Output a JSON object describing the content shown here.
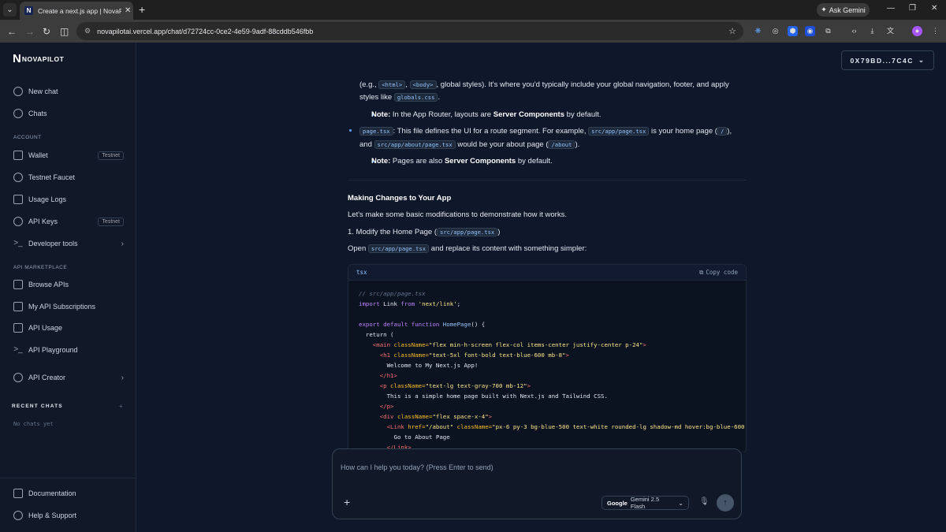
{
  "browser": {
    "tab_title": "Create a next.js app | NovaPilot",
    "tab_favicon": "N",
    "ask_gemini": "Ask Gemini",
    "url": "novapilotai.vercel.app/chat/d72724cc-0ce2-4e59-9adf-88cddb546fbb"
  },
  "sidebar": {
    "logo": "NOVAPILOT",
    "logo_mark": "N",
    "new_chat": "New chat",
    "chats": "Chats",
    "account_heading": "ACCOUNT",
    "wallet": "Wallet",
    "wallet_badge": "Testnet",
    "faucet": "Testnet Faucet",
    "usage_logs": "Usage Logs",
    "api_keys": "API Keys",
    "api_keys_badge": "Testnet",
    "dev_tools": "Developer tools",
    "marketplace_heading": "API MARKETPLACE",
    "browse_apis": "Browse APIs",
    "my_subs": "My API Subscriptions",
    "api_usage": "API Usage",
    "api_playground": "API Playground",
    "api_creator": "API Creator",
    "recent_heading": "RECENT CHATS",
    "no_chats": "No chats yet",
    "documentation": "Documentation",
    "help": "Help & Support"
  },
  "wallet_button": "0X79BD...7C4C",
  "message": {
    "p1_a": "(e.g., ",
    "code_html": "<html>",
    "p1_b": ", ",
    "code_body": "<body>",
    "p1_c": ", global styles). It's where you'd typically include your global navigation, footer, and apply",
    "p1_d": "styles like ",
    "code_globals": "globals.css",
    "p1_e": ".",
    "note1_label": "Note:",
    "note1_a": " In the App Router, layouts are ",
    "note1_bold": "Server Components",
    "note1_b": " by default.",
    "code_page": "page.tsx",
    "p2_a": ": This file defines the UI for a route segment. For example, ",
    "code_apppage": "src/app/page.tsx",
    "p2_b": " is your home page (",
    "code_slash": "/",
    "p2_c": "),",
    "p2_d": "and ",
    "code_about": "src/app/about/page.tsx",
    "p2_e": " would be your about page (",
    "code_aboutpath": "/about",
    "p2_f": ").",
    "note2_label": "Note:",
    "note2_a": " Pages are also ",
    "note2_bold": "Server Components",
    "note2_b": " by default.",
    "heading": "Making Changes to Your App",
    "intro": "Let's make some basic modifications to demonstrate how it works.",
    "step1_a": "1. Modify the Home Page (",
    "code_step1": "src/app/page.tsx",
    "step1_b": ")",
    "open_a": "Open ",
    "code_open": "src/app/page.tsx",
    "open_b": " and replace its content with something simpler:"
  },
  "codeblock": {
    "lang": "tsx",
    "copy": "Copy code",
    "comment": "// src/app/page.tsx",
    "import_kw": "import",
    "import_name": " Link ",
    "from_kw": "from",
    "import_str": " 'next/link'",
    "import_end": ";",
    "export_kw": "export default function",
    "fn_name": " HomePage",
    "fn_end": "() {",
    "return": "  return (",
    "main_open_tag": "    <main",
    "main_attr": " className=",
    "main_val": "\"flex min-h-screen flex-col items-center justify-center p-24\"",
    "main_close": ">",
    "h1_open_tag": "      <h1",
    "h1_attr": " className=",
    "h1_val": "\"text-5xl font-bold text-blue-600 mb-8\"",
    "h1_close": ">",
    "h1_text": "        Welcome to My Next.js App!",
    "h1_end": "      </h1>",
    "p_open_tag": "      <p",
    "p_attr": " className=",
    "p_val": "\"text-lg text-gray-700 mb-12\"",
    "p_close": ">",
    "p_text": "        This is a simple home page built with Next.js and Tailwind CSS.",
    "p_end": "      </p>",
    "div_open_tag": "      <div",
    "div_attr": " className=",
    "div_val": "\"flex space-x-4\"",
    "div_close": ">",
    "link_open_tag": "        <Link",
    "link_attr1": " href=",
    "link_val1": "\"/about\"",
    "link_attr2": " className=",
    "link_val2": "\"px-6 py-3 bg-blue-500 text-white rounded-lg shadow-md hover:bg-blue-600",
    "link_text": "          Go to About Page",
    "link_end": "        </Link>"
  },
  "composer": {
    "placeholder": "How can I help you today? (Press Enter to send)",
    "provider": "Google",
    "model": "Gemini 2.5 Flash"
  }
}
